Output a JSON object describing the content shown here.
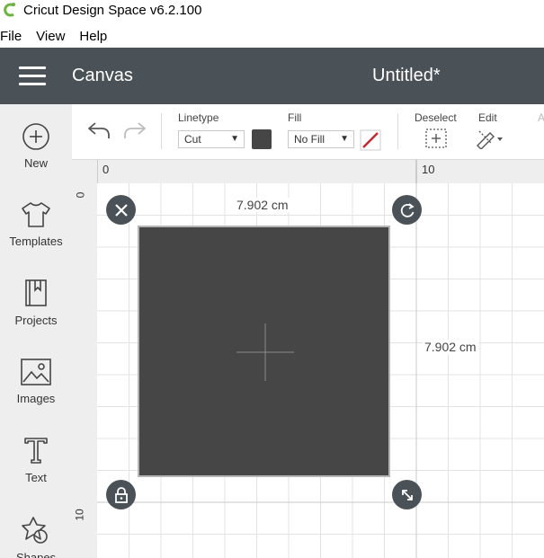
{
  "window": {
    "title": "Cricut Design Space  v6.2.100",
    "logo_icon": "cricut-c-logo-icon",
    "logo_color": "#6cb33f"
  },
  "menubar": {
    "items": [
      "File",
      "View",
      "Help"
    ]
  },
  "header": {
    "section_title": "Canvas",
    "document_title": "Untitled*",
    "background": "#4b5257"
  },
  "sidebar": {
    "items": [
      {
        "label": "New",
        "icon": "plus-circle-icon"
      },
      {
        "label": "Templates",
        "icon": "tshirt-icon"
      },
      {
        "label": "Projects",
        "icon": "bookmark-book-icon"
      },
      {
        "label": "Images",
        "icon": "image-icon"
      },
      {
        "label": "Text",
        "icon": "text-t-icon"
      },
      {
        "label": "Shapes",
        "icon": "shapes-icon"
      }
    ]
  },
  "toolbar": {
    "undo_icon": "undo-icon",
    "redo_icon": "redo-icon",
    "linetype_label": "Linetype",
    "linetype_value": "Cut",
    "linetype_color": "#464646",
    "fill_label": "Fill",
    "fill_value": "No Fill",
    "deselect_label": "Deselect",
    "edit_label": "Edit",
    "overflow_label": "A"
  },
  "rulers": {
    "top": [
      "0",
      "10"
    ],
    "left": [
      "0",
      "10"
    ]
  },
  "canvas": {
    "shape_color": "#464646",
    "width_label": "7.902 cm",
    "height_label": "7.902 cm",
    "handles": [
      "delete-x-icon",
      "rotate-icon",
      "lock-icon",
      "resize-arrows-icon"
    ]
  }
}
